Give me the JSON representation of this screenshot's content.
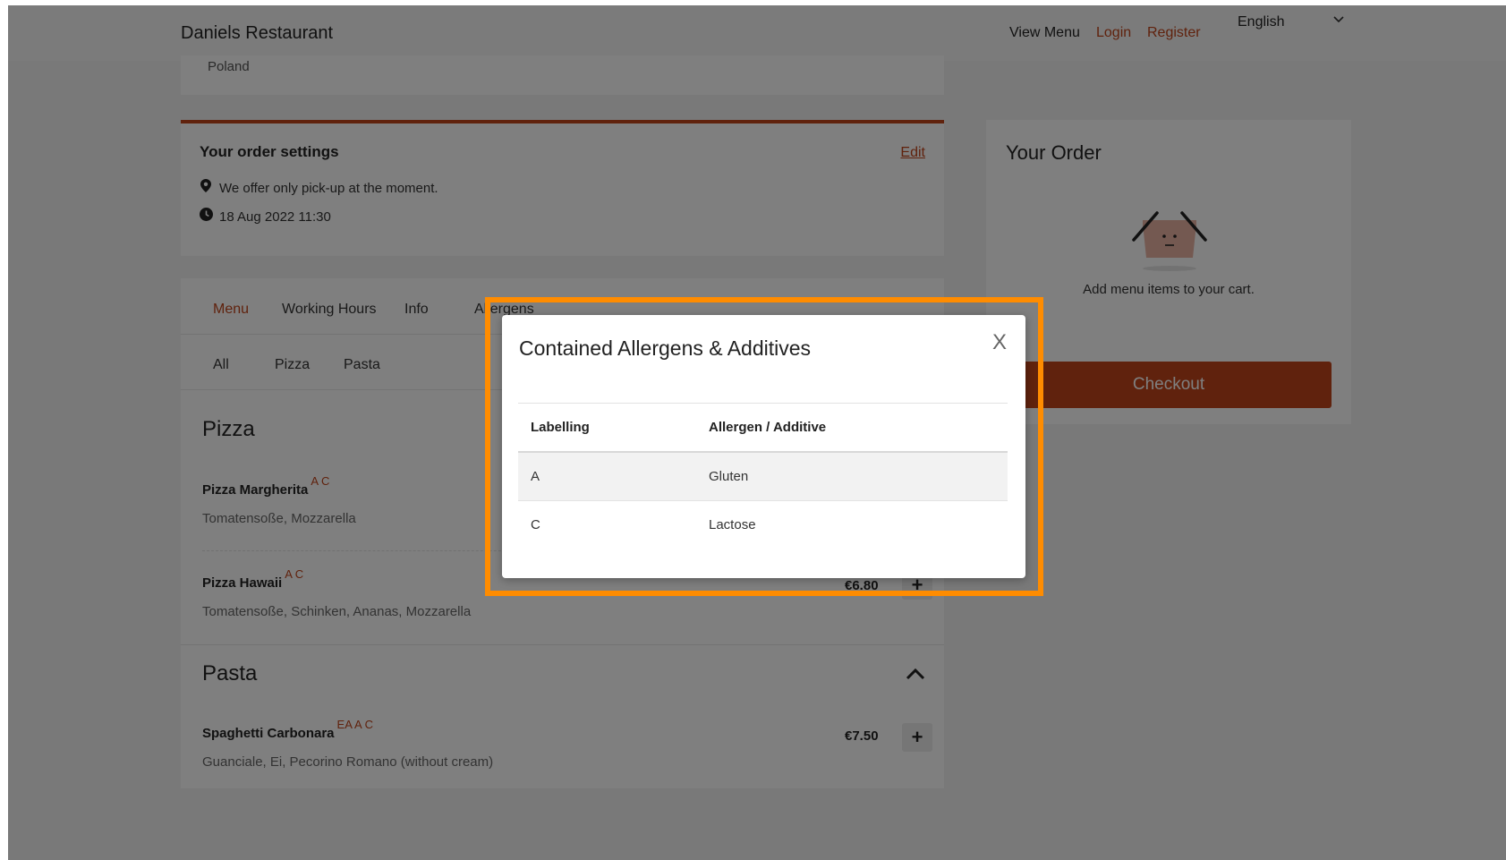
{
  "header": {
    "brand": "Daniels Restaurant",
    "nav": {
      "view_menu": "View Menu",
      "login": "Login",
      "register": "Register"
    },
    "language": "English"
  },
  "address": {
    "country": "Poland"
  },
  "order_settings": {
    "title": "Your order settings",
    "edit": "Edit",
    "pickup": "We offer only pick-up at the moment.",
    "datetime": "18 Aug 2022 11:30"
  },
  "menu": {
    "tabs": [
      "Menu",
      "Working Hours",
      "Info",
      "Allergens"
    ],
    "categories": [
      "All",
      "Pizza",
      "Pasta"
    ],
    "sections": [
      {
        "title": "Pizza",
        "items": [
          {
            "name": "Pizza Margherita",
            "allergens": "A C",
            "description": "Tomatensoße, Mozzarella",
            "price": ""
          },
          {
            "name": "Pizza Hawaii",
            "allergens": "A C",
            "description": "Tomatensoße, Schinken, Ananas, Mozzarella",
            "price": "€6.80"
          }
        ]
      },
      {
        "title": "Pasta",
        "items": [
          {
            "name": "Spaghetti Carbonara",
            "allergens": "EA A C",
            "description": "Guanciale, Ei, Pecorino Romano (without cream)",
            "price": "€7.50"
          }
        ]
      }
    ],
    "add_symbol": "+"
  },
  "your_order": {
    "title": "Your Order",
    "empty_text": "Add menu items to your cart.",
    "checkout": "Checkout"
  },
  "modal": {
    "title": "Contained Allergens & Additives",
    "close": "X",
    "headers": [
      "Labelling",
      "Allergen / Additive"
    ],
    "rows": [
      {
        "label": "A",
        "name": "Gluten"
      },
      {
        "label": "C",
        "name": "Lactose"
      }
    ]
  },
  "colors": {
    "accent": "#c0441a",
    "highlight": "#ff8c00"
  },
  "icons": [
    "chevron-down-icon",
    "map-pin-icon",
    "clock-icon",
    "chevron-up-icon",
    "empty-basket-icon",
    "plus-icon",
    "close-icon"
  ]
}
